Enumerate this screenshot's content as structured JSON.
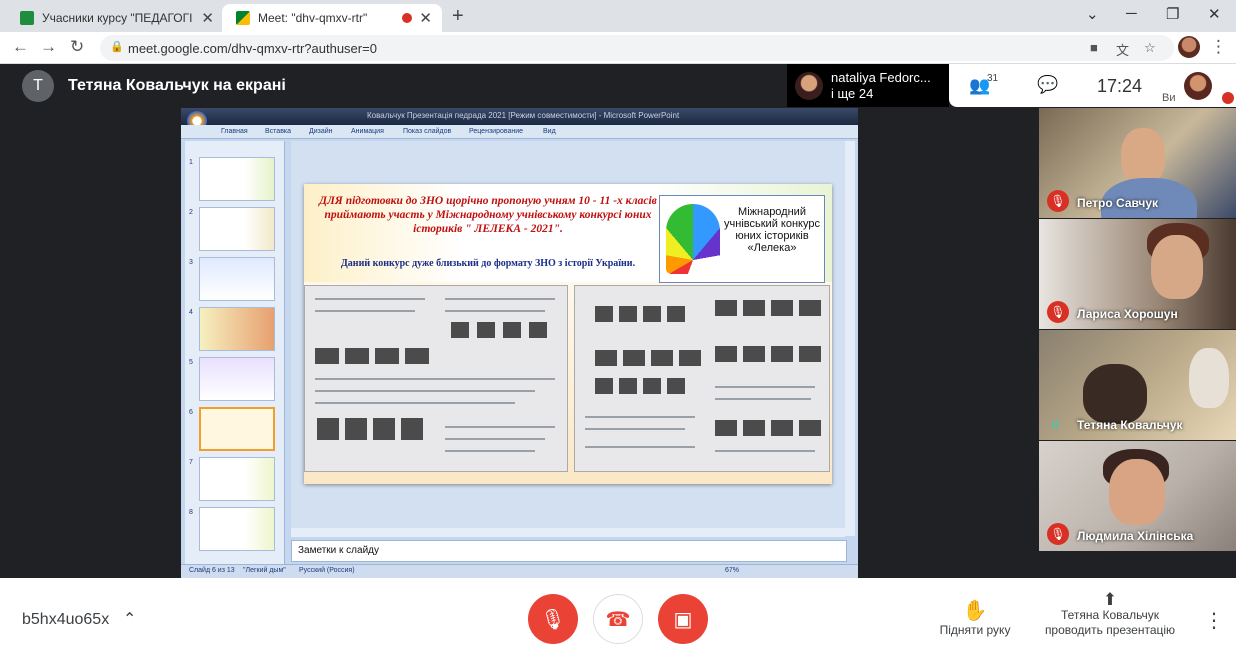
{
  "browser": {
    "tabs": [
      {
        "title": "Учасники курсу \"ПЕДАГОГІЧНА",
        "favicon": "classroom-icon",
        "color": "#1e8e3e"
      },
      {
        "title": "Meet: \"dhv-qmxv-rtr\"",
        "favicon": "meet-icon",
        "color": "#00832d"
      }
    ],
    "url": "meet.google.com/dhv-qmxv-rtr?authuser=0",
    "new_tab": "+",
    "win_minimize": "─",
    "win_restore": "❐",
    "win_close": "✕"
  },
  "meet": {
    "presenter_initial": "Т",
    "presenter_title": "Тетяна Ковальчук на екрані",
    "viewer_name": "nataliya Fedorc...",
    "viewer_more": "і ще 24",
    "people_count": "31",
    "clock": "17:24",
    "self_label": "Ви",
    "meeting_code": "b5hx4uo65x",
    "raise_hand": "Підняти руку",
    "presenting_note": "Тетяна Ковальчук проводить презентацію"
  },
  "ppt": {
    "title_text": "Ковальчук Презентація педрада 2021 [Режим совместимости] - Microsoft PowerPoint",
    "ribbon_tabs": [
      "Главная",
      "Вставка",
      "Дизайн",
      "Анимация",
      "Показ слайдов",
      "Рецензирование",
      "Вид"
    ],
    "thumb_numbers": [
      "1",
      "2",
      "3",
      "4",
      "5",
      "6",
      "7",
      "8"
    ],
    "selected_slide": 6,
    "slide": {
      "headline": "ДЛЯ підготовки до ЗНО щорічно пропоную учням 10 - 11 -х класів приймають участь у Міжнародному учнівському конкурсі юних істориків \" ЛЕЛЕКА - 2021\".",
      "subline": "Даний конкурс дуже близький до формату ЗНО з історії України.",
      "logo_text": "Міжнародний учнівський конкурс юних істориків «Лелека»"
    },
    "notes_placeholder": "Заметки к слайду",
    "status_slide": "Слайд 6 из 13",
    "status_theme": "\"Легкий дым\"",
    "status_lang": "Русский (Россия)",
    "status_zoom": "67%"
  },
  "participants": [
    {
      "name": "Петро Савчук",
      "muted": true
    },
    {
      "name": "Лариса Хорошун",
      "muted": true
    },
    {
      "name": "Тетяна Ковальчук",
      "muted": false
    },
    {
      "name": "Людмила Хілінська",
      "muted": true
    }
  ],
  "colors": {
    "meet_bg": "#202124",
    "danger": "#d93025",
    "brand_red": "#ea4335"
  }
}
